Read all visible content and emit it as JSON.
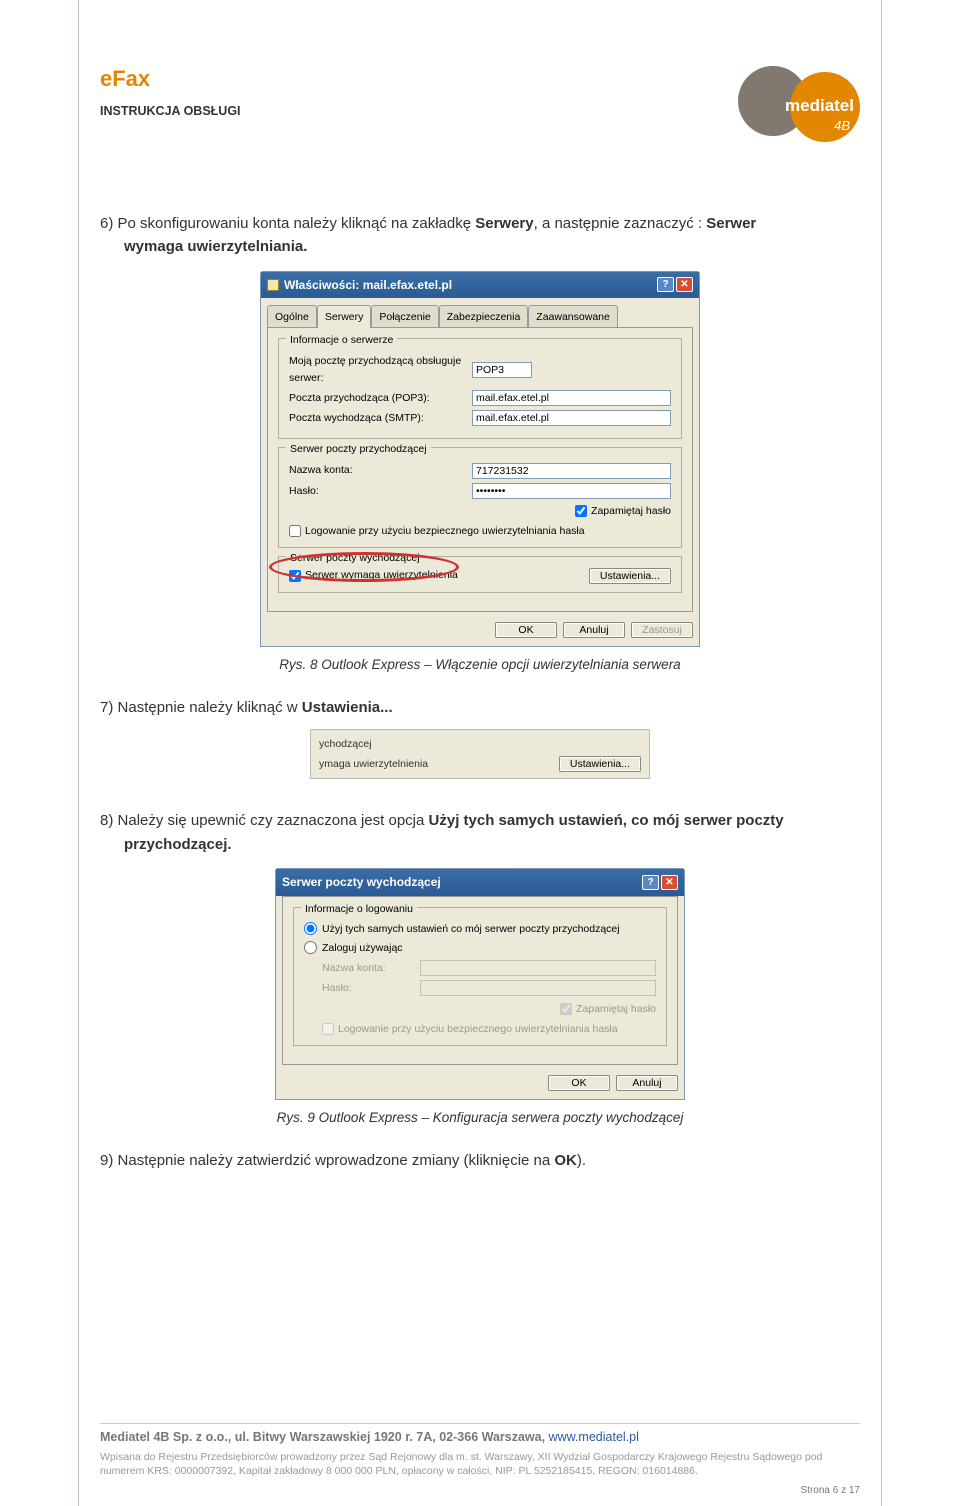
{
  "header": {
    "brand": "eFax",
    "subtitle": "INSTRUKCJA OBSŁUGI",
    "logo_text": "mediatel",
    "logo_sub": "4B"
  },
  "step6": {
    "num": "6)",
    "t1": "Po skonfigurowaniu konta należy kliknąć na zakładkę ",
    "b1": "Serwery",
    "t2": ", a następnie zaznaczyć : ",
    "b2": "Serwer wymaga uwierzytelniania.",
    "cont": "wymaga uwierzytelniania."
  },
  "dlg1": {
    "title": "Właściwości: mail.efax.etel.pl",
    "tabs": [
      "Ogólne",
      "Serwery",
      "Połączenie",
      "Zabezpieczenia",
      "Zaawansowane"
    ],
    "g1": "Informacje o serwerze",
    "r1_lbl": "Moją pocztę przychodzącą obsługuje serwer:",
    "r1_val": "POP3",
    "r2_lbl": "Poczta przychodząca (POP3):",
    "r2_val": "mail.efax.etel.pl",
    "r3_lbl": "Poczta wychodząca (SMTP):",
    "r3_val": "mail.efax.etel.pl",
    "g2": "Serwer poczty przychodzącej",
    "r4_lbl": "Nazwa konta:",
    "r4_val": "717231532",
    "r5_lbl": "Hasło:",
    "r5_val": "••••••••",
    "chk1": "Zapamiętaj hasło",
    "chk2": "Logowanie przy użyciu bezpiecznego uwierzytelniania hasła",
    "g3": "Serwer poczty wychodzącej",
    "chk3": "Serwer wymaga uwierzytelnienia",
    "btn_settings": "Ustawienia...",
    "ok": "OK",
    "cancel": "Anuluj",
    "apply": "Zastosuj"
  },
  "caption1": "Rys. 8 Outlook Express – Włączenie opcji uwierzytelniania serwera",
  "step7": {
    "num": "7)",
    "t1": "Następnie należy kliknąć w ",
    "b1": "Ustawienia..."
  },
  "snippet": {
    "l1": "ychodzącej",
    "l2": "ymaga uwierzytelnienia",
    "btn": "Ustawienia..."
  },
  "step8": {
    "num": "8)",
    "t1": "Należy się upewnić czy zaznaczona jest opcja ",
    "b1": "Użyj tych samych ustawień, co mój serwer poczty przychodzącej.",
    "cont": "przychodzącej."
  },
  "dlg3": {
    "title": "Serwer poczty wychodzącej",
    "g1": "Informacje o logowaniu",
    "opt1": "Użyj tych samych ustawień co mój serwer poczty przychodzącej",
    "opt2": "Zaloguj używając",
    "r1_lbl": "Nazwa konta:",
    "r2_lbl": "Hasło:",
    "chk1": "Zapamiętaj hasło",
    "chk2": "Logowanie przy użyciu bezpiecznego uwierzytelniania hasła",
    "ok": "OK",
    "cancel": "Anuluj"
  },
  "caption2": "Rys. 9 Outlook Express – Konfiguracja serwera poczty wychodzącej",
  "step9": {
    "num": "9)",
    "t1": "Następnie należy zatwierdzić wprowadzone zmiany (kliknięcie na ",
    "b1": "OK",
    "t2": ")."
  },
  "footer": {
    "addr1": "Mediatel 4B Sp. z o.o., ul. Bitwy Warszawskiej 1920 r. 7A, 02-366 Warszawa, ",
    "link": "www.mediatel.pl",
    "legal": "Wpisana do Rejestru Przedsiębiorców prowadzony przez Sąd Rejonowy dla m. st. Warszawy, XII Wydział Gospodarczy Krajowego Rejestru Sądowego pod numerem KRS: 0000007392, Kapitał  zakładowy 8 000 000 PLN, opłacony w całości, NIP: PL 5252185415, REGON: 016014886.",
    "page": "Strona 6 z 17"
  }
}
